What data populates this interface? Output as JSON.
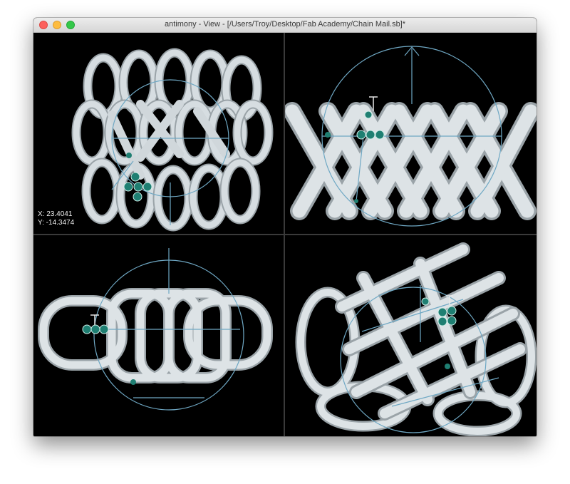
{
  "window": {
    "title": "antimony - View - [/Users/Troy/Desktop/Fab Academy/Chain Mail.sb]*"
  },
  "viewports": {
    "top_left": {
      "coords": {
        "x_label": "X: 23.4041",
        "y_label": "Y: -14.3474"
      }
    }
  },
  "colors": {
    "background": "#000000",
    "mesh": "#c9d1d6",
    "gizmo": "#6fa8c4",
    "handle": "#1f7f72"
  }
}
